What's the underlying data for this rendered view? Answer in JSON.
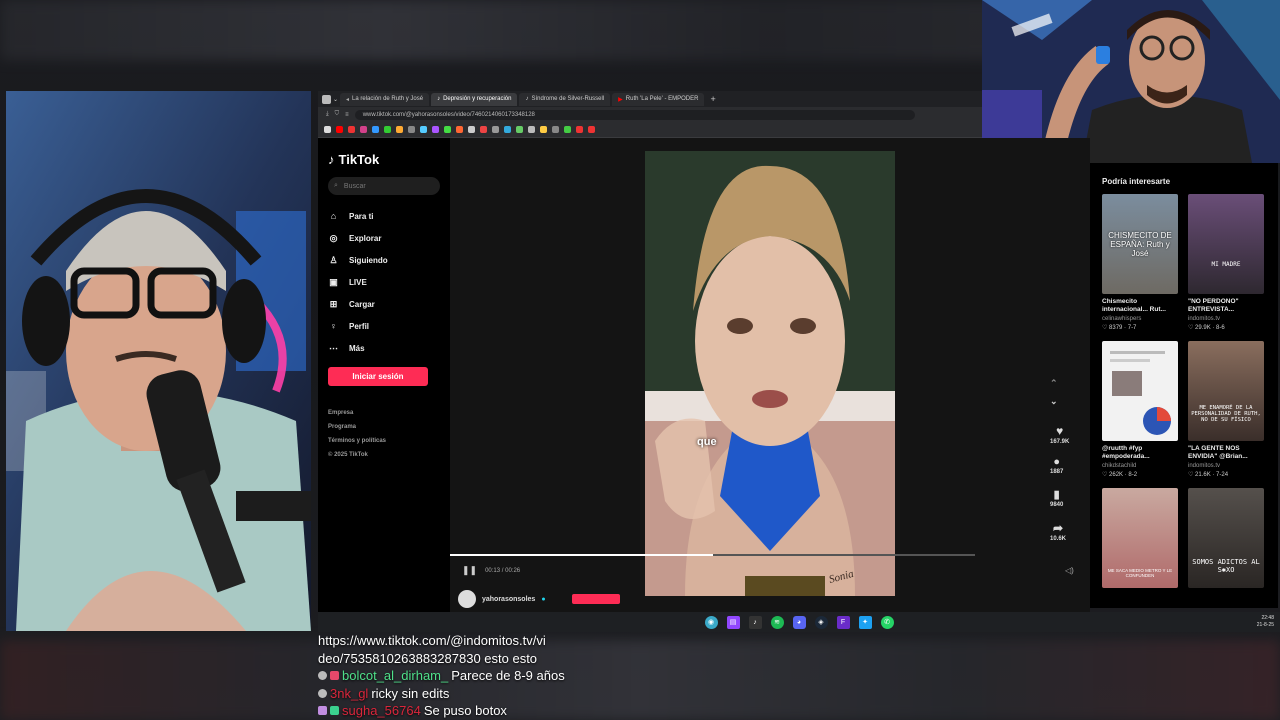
{
  "browser": {
    "tabs": [
      {
        "label": "La relación de Ruth y José",
        "active": false
      },
      {
        "label": "Depresión y recuperación",
        "active": true
      },
      {
        "label": "Síndrome de Silver-Russell",
        "active": false
      },
      {
        "label": "Ruth 'La Pele' - EMPODER",
        "active": false
      }
    ],
    "new_tab": "+",
    "url": "www.tiktok.com/@yahorasonsoles/video/7460214060173348128"
  },
  "tiktok": {
    "brand": "TikTok",
    "search_placeholder": "Buscar",
    "nav": [
      {
        "label": "Para ti",
        "icon": "⌂"
      },
      {
        "label": "Explorar",
        "icon": "◎"
      },
      {
        "label": "Siguiendo",
        "icon": "♙"
      },
      {
        "label": "LIVE",
        "icon": "▣"
      },
      {
        "label": "Cargar",
        "icon": "⊞"
      },
      {
        "label": "Perfil",
        "icon": "♀"
      },
      {
        "label": "Más",
        "icon": "⋯"
      }
    ],
    "login_label": "Iniciar sesión",
    "footer": [
      "Empresa",
      "Programa",
      "Términos y políticas",
      "© 2025 TikTok"
    ]
  },
  "video": {
    "caption": "que",
    "likes": "167.9K",
    "comments": "1887",
    "saves": "9840",
    "shares": "10.6K",
    "time": "00:13 / 00:26",
    "username": "yahorasonsoles",
    "progress": 0.5,
    "tattoo": "Sonia"
  },
  "recommendations": {
    "title": "Podría interesarte",
    "items": [
      {
        "thumb_text": "CHISMECITO DE ESPAÑA: Ruth y José",
        "title": "Chismecito internacional... Rut...",
        "author": "celinawhispers",
        "meta": "♡ 8379 · 7-7",
        "color": "#6e6a63"
      },
      {
        "thumb_text": "MI MADRE",
        "title": "\"NO PERDONO\" ENTREVISTA...",
        "author": "indomitos.tv",
        "meta": "♡ 29.9K · 8-6",
        "color": "#4a3f55"
      },
      {
        "thumb_text": "",
        "title": "@ruutth #fyp #empoderada...",
        "author": "chikdstachild",
        "meta": "♡ 262K · 8-2",
        "color": "#e8e8e8"
      },
      {
        "thumb_text": "ME ENAMORÉ DE LA PERSONALIDAD DE RUTH, NO DE SU FÍSICO",
        "title": "\"LA GENTE NOS ENVIDIA\" @Brian...",
        "author": "indomitos.tv",
        "meta": "♡ 21.6K · 7-24",
        "color": "#5a4a44"
      },
      {
        "thumb_text": "ME SACA MEDIO METRO Y LE CONFUNDEN",
        "title": "",
        "author": "",
        "meta": "",
        "color": "#b8a7a0"
      },
      {
        "thumb_text": "SOMOS ADICTOS AL S✱XO",
        "title": "",
        "author": "",
        "meta": "",
        "color": "#3e3a38"
      }
    ]
  },
  "taskbar": {
    "time": "22:48",
    "date": "21-8-25"
  },
  "chat": [
    {
      "user": "",
      "color": "#ffffff",
      "text": "https://www.tiktok.com/@indomitos.tv/vi"
    },
    {
      "user": "",
      "color": "#ffffff",
      "text": "deo/7535810263883287830 esto esto"
    },
    {
      "user": "bolcot_al_dirham_",
      "color": "#4fe08a",
      "text": "Parece de 8-9 años"
    },
    {
      "user": "3nk_gl",
      "color": "#d9263b",
      "text": "ricky sin edits"
    },
    {
      "user": "sugha_56764",
      "color": "#d9263b",
      "text": "Se puso botox"
    }
  ]
}
